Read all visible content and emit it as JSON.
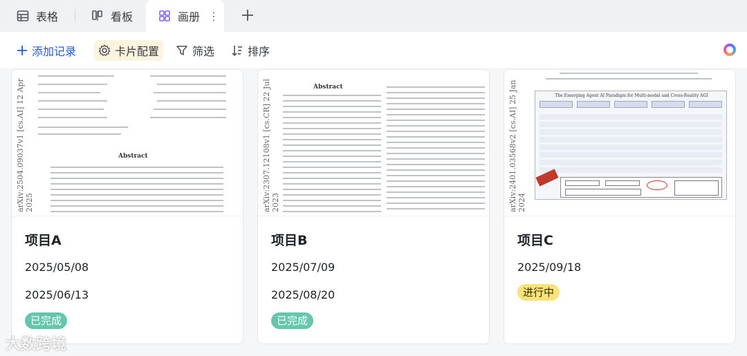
{
  "tabs": [
    {
      "label": "表格",
      "icon": "table-icon"
    },
    {
      "label": "看板",
      "icon": "kanban-icon"
    },
    {
      "label": "画册",
      "icon": "gallery-icon",
      "active": true
    }
  ],
  "toolbar": {
    "add_label": "添加记录",
    "card_label": "卡片配置",
    "filter_label": "筛选",
    "sort_label": "排序"
  },
  "cards": [
    {
      "title": "项目A",
      "date1": "2025/05/08",
      "date2": "2025/06/13",
      "status": "已完成",
      "cover": {
        "arxiv": "arXiv:2504.09037v1 [cs.AI] 12 Apr 2025",
        "heading": "Abstract"
      }
    },
    {
      "title": "项目B",
      "date1": "2025/07/09",
      "date2": "2025/08/20",
      "status": "已完成",
      "cover": {
        "arxiv": "arXiv:2307.12108v1 [cs.CR] 22 Jul 2023",
        "heading": "Abstract"
      }
    },
    {
      "title": "项目C",
      "date1": "2025/09/18",
      "date2": "",
      "status": "进行中",
      "cover": {
        "arxiv": "arXiv:2401.03568v2 [cs.AI] 25 Jan 2024",
        "heading": "The Emerging Agent AI Paradigm for Multi-modal and Cross-Reality AGI"
      }
    }
  ],
  "watermark": "大数跨境",
  "colors": {
    "accent": "#245bdb",
    "done_badge": "#64c7ad",
    "progress_badge": "#f8e27a"
  }
}
